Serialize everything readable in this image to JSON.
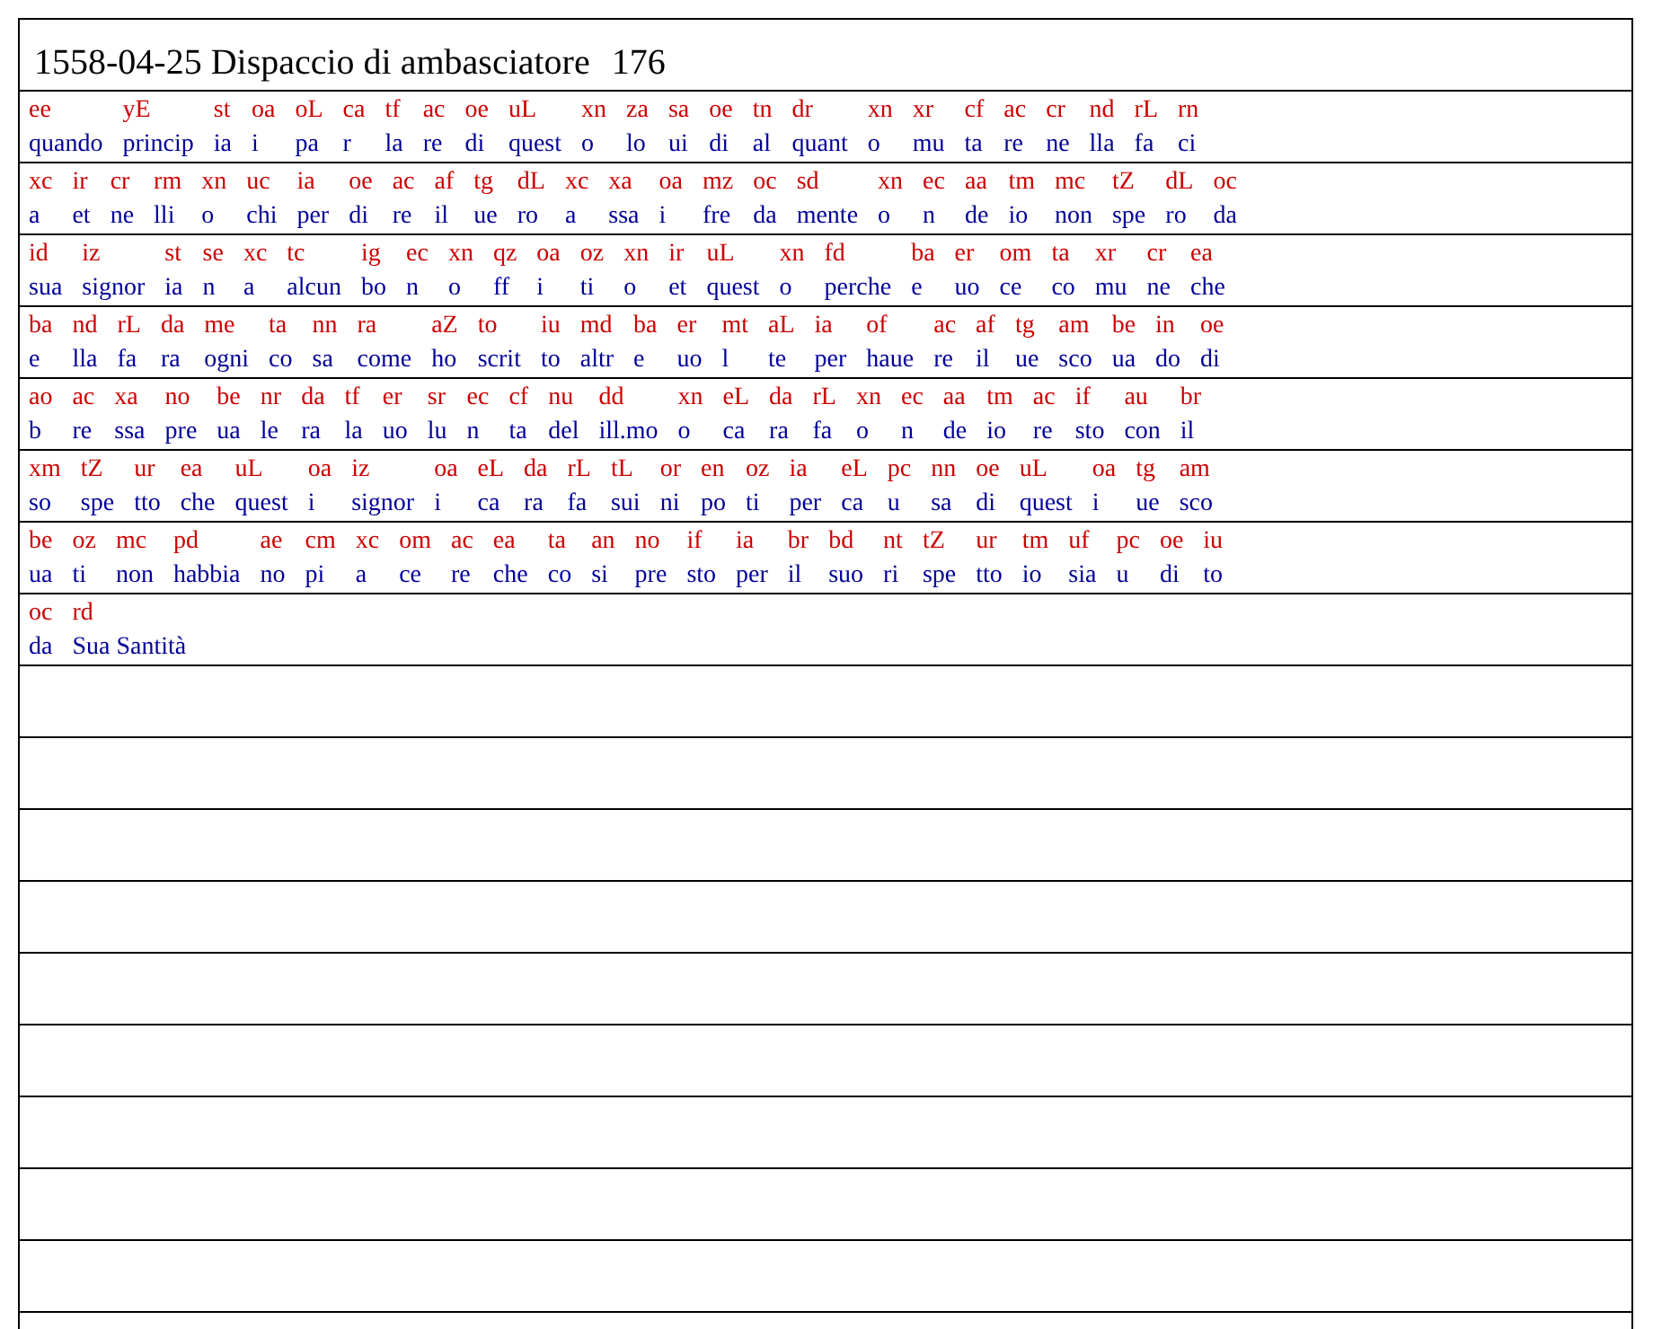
{
  "title": {
    "heading": "1558-04-25 Dispaccio di ambasciatore",
    "number": "176"
  },
  "rows": [
    {
      "pairs": [
        {
          "code": "ee",
          "plain": "quando"
        },
        {
          "code": "yE",
          "plain": "princip"
        },
        {
          "code": "st",
          "plain": "ia"
        },
        {
          "code": "oa",
          "plain": "i"
        },
        {
          "code": "oL",
          "plain": "pa"
        },
        {
          "code": "ca",
          "plain": "r"
        },
        {
          "code": "tf",
          "plain": "la"
        },
        {
          "code": "ac",
          "plain": "re"
        },
        {
          "code": "oe",
          "plain": "di"
        },
        {
          "code": "uL",
          "plain": "quest"
        },
        {
          "code": "xn",
          "plain": "o"
        },
        {
          "code": "za",
          "plain": "lo"
        },
        {
          "code": "sa",
          "plain": "ui"
        },
        {
          "code": "oe",
          "plain": "di"
        },
        {
          "code": "tn",
          "plain": "al"
        },
        {
          "code": "dr",
          "plain": "quant"
        },
        {
          "code": "xn",
          "plain": "o"
        },
        {
          "code": "xr",
          "plain": "mu"
        },
        {
          "code": "cf",
          "plain": "ta"
        },
        {
          "code": "ac",
          "plain": "re"
        },
        {
          "code": "cr",
          "plain": "ne"
        },
        {
          "code": "nd",
          "plain": "lla"
        },
        {
          "code": "rL",
          "plain": "fa"
        },
        {
          "code": "rn",
          "plain": "ci"
        }
      ]
    },
    {
      "pairs": [
        {
          "code": "xc",
          "plain": "a"
        },
        {
          "code": "ir",
          "plain": "et"
        },
        {
          "code": "cr",
          "plain": "ne"
        },
        {
          "code": "rm",
          "plain": "lli"
        },
        {
          "code": "xn",
          "plain": "o"
        },
        {
          "code": "uc",
          "plain": "chi"
        },
        {
          "code": "ia",
          "plain": "per"
        },
        {
          "code": "oe",
          "plain": "di"
        },
        {
          "code": "ac",
          "plain": "re"
        },
        {
          "code": "af",
          "plain": "il"
        },
        {
          "code": "tg",
          "plain": "ue"
        },
        {
          "code": "dL",
          "plain": "ro"
        },
        {
          "code": "xc",
          "plain": "a"
        },
        {
          "code": "xa",
          "plain": "ssa"
        },
        {
          "code": "oa",
          "plain": "i"
        },
        {
          "code": "mz",
          "plain": "fre"
        },
        {
          "code": "oc",
          "plain": "da"
        },
        {
          "code": "sd",
          "plain": "mente"
        },
        {
          "code": "xn",
          "plain": "o"
        },
        {
          "code": "ec",
          "plain": "n"
        },
        {
          "code": "aa",
          "plain": "de"
        },
        {
          "code": "tm",
          "plain": "io"
        },
        {
          "code": "mc",
          "plain": "non"
        },
        {
          "code": "tZ",
          "plain": "spe"
        },
        {
          "code": "dL",
          "plain": "ro"
        },
        {
          "code": "oc",
          "plain": "da"
        }
      ]
    },
    {
      "pairs": [
        {
          "code": "id",
          "plain": "sua"
        },
        {
          "code": "iz",
          "plain": "signor"
        },
        {
          "code": "st",
          "plain": "ia"
        },
        {
          "code": "se",
          "plain": "n"
        },
        {
          "code": "xc",
          "plain": "a"
        },
        {
          "code": "tc",
          "plain": "alcun"
        },
        {
          "code": "ig",
          "plain": "bo"
        },
        {
          "code": "ec",
          "plain": "n"
        },
        {
          "code": "xn",
          "plain": "o"
        },
        {
          "code": "qz",
          "plain": "ff"
        },
        {
          "code": "oa",
          "plain": "i"
        },
        {
          "code": "oz",
          "plain": "ti"
        },
        {
          "code": "xn",
          "plain": "o"
        },
        {
          "code": "ir",
          "plain": "et"
        },
        {
          "code": "uL",
          "plain": "quest"
        },
        {
          "code": "xn",
          "plain": "o"
        },
        {
          "code": "fd",
          "plain": "perche"
        },
        {
          "code": "ba",
          "plain": "e"
        },
        {
          "code": "er",
          "plain": "uo"
        },
        {
          "code": "om",
          "plain": "ce"
        },
        {
          "code": "ta",
          "plain": "co"
        },
        {
          "code": "xr",
          "plain": "mu"
        },
        {
          "code": "cr",
          "plain": "ne"
        },
        {
          "code": "ea",
          "plain": "che"
        }
      ]
    },
    {
      "pairs": [
        {
          "code": "ba",
          "plain": "e"
        },
        {
          "code": "nd",
          "plain": "lla"
        },
        {
          "code": "rL",
          "plain": "fa"
        },
        {
          "code": "da",
          "plain": "ra"
        },
        {
          "code": "me",
          "plain": "ogni"
        },
        {
          "code": "ta",
          "plain": "co"
        },
        {
          "code": "nn",
          "plain": "sa"
        },
        {
          "code": "ra",
          "plain": "come"
        },
        {
          "code": "aZ",
          "plain": "ho"
        },
        {
          "code": "to",
          "plain": "scrit"
        },
        {
          "code": "iu",
          "plain": "to"
        },
        {
          "code": "md",
          "plain": "altr"
        },
        {
          "code": "ba",
          "plain": "e"
        },
        {
          "code": "er",
          "plain": "uo"
        },
        {
          "code": "mt",
          "plain": "l"
        },
        {
          "code": "aL",
          "plain": "te"
        },
        {
          "code": "ia",
          "plain": "per"
        },
        {
          "code": "of",
          "plain": "haue"
        },
        {
          "code": "ac",
          "plain": "re"
        },
        {
          "code": "af",
          "plain": "il"
        },
        {
          "code": "tg",
          "plain": "ue"
        },
        {
          "code": "am",
          "plain": "sco"
        },
        {
          "code": "be",
          "plain": "ua"
        },
        {
          "code": "in",
          "plain": "do"
        },
        {
          "code": "oe",
          "plain": "di"
        }
      ]
    },
    {
      "pairs": [
        {
          "code": "ao",
          "plain": "b"
        },
        {
          "code": "ac",
          "plain": "re"
        },
        {
          "code": "xa",
          "plain": "ssa"
        },
        {
          "code": "no",
          "plain": "pre"
        },
        {
          "code": "be",
          "plain": "ua"
        },
        {
          "code": "nr",
          "plain": "le"
        },
        {
          "code": "da",
          "plain": "ra"
        },
        {
          "code": "tf",
          "plain": "la"
        },
        {
          "code": "er",
          "plain": "uo"
        },
        {
          "code": "sr",
          "plain": "lu"
        },
        {
          "code": "ec",
          "plain": "n"
        },
        {
          "code": "cf",
          "plain": "ta"
        },
        {
          "code": "nu",
          "plain": "del"
        },
        {
          "code": "dd",
          "plain": "ill.mo"
        },
        {
          "code": "xn",
          "plain": "o"
        },
        {
          "code": "eL",
          "plain": "ca"
        },
        {
          "code": "da",
          "plain": "ra"
        },
        {
          "code": "rL",
          "plain": "fa"
        },
        {
          "code": "xn",
          "plain": "o"
        },
        {
          "code": "ec",
          "plain": "n"
        },
        {
          "code": "aa",
          "plain": "de"
        },
        {
          "code": "tm",
          "plain": "io"
        },
        {
          "code": "ac",
          "plain": "re"
        },
        {
          "code": "if",
          "plain": "sto"
        },
        {
          "code": "au",
          "plain": "con"
        },
        {
          "code": "br",
          "plain": "il"
        }
      ]
    },
    {
      "pairs": [
        {
          "code": "xm",
          "plain": "so"
        },
        {
          "code": "tZ",
          "plain": "spe"
        },
        {
          "code": "ur",
          "plain": "tto"
        },
        {
          "code": "ea",
          "plain": "che"
        },
        {
          "code": "uL",
          "plain": "quest"
        },
        {
          "code": "oa",
          "plain": "i"
        },
        {
          "code": "iz",
          "plain": "signor"
        },
        {
          "code": "oa",
          "plain": "i"
        },
        {
          "code": "eL",
          "plain": "ca"
        },
        {
          "code": "da",
          "plain": "ra"
        },
        {
          "code": "rL",
          "plain": "fa"
        },
        {
          "code": "tL",
          "plain": "sui"
        },
        {
          "code": "or",
          "plain": "ni"
        },
        {
          "code": "en",
          "plain": "po"
        },
        {
          "code": "oz",
          "plain": "ti"
        },
        {
          "code": "ia",
          "plain": "per"
        },
        {
          "code": "eL",
          "plain": "ca"
        },
        {
          "code": "pc",
          "plain": "u"
        },
        {
          "code": "nn",
          "plain": "sa"
        },
        {
          "code": "oe",
          "plain": "di"
        },
        {
          "code": "uL",
          "plain": "quest"
        },
        {
          "code": "oa",
          "plain": "i"
        },
        {
          "code": "tg",
          "plain": "ue"
        },
        {
          "code": "am",
          "plain": "sco"
        }
      ]
    },
    {
      "pairs": [
        {
          "code": "be",
          "plain": "ua"
        },
        {
          "code": "oz",
          "plain": "ti"
        },
        {
          "code": "mc",
          "plain": "non"
        },
        {
          "code": "pd",
          "plain": "habbia"
        },
        {
          "code": "ae",
          "plain": "no"
        },
        {
          "code": "cm",
          "plain": "pi"
        },
        {
          "code": "xc",
          "plain": "a"
        },
        {
          "code": "om",
          "plain": "ce"
        },
        {
          "code": "ac",
          "plain": "re"
        },
        {
          "code": "ea",
          "plain": "che"
        },
        {
          "code": "ta",
          "plain": "co"
        },
        {
          "code": "an",
          "plain": "si"
        },
        {
          "code": "no",
          "plain": "pre"
        },
        {
          "code": "if",
          "plain": "sto"
        },
        {
          "code": "ia",
          "plain": "per"
        },
        {
          "code": "br",
          "plain": "il"
        },
        {
          "code": "bd",
          "plain": "suo"
        },
        {
          "code": "nt",
          "plain": "ri"
        },
        {
          "code": "tZ",
          "plain": "spe"
        },
        {
          "code": "ur",
          "plain": "tto"
        },
        {
          "code": "tm",
          "plain": "io"
        },
        {
          "code": "uf",
          "plain": "sia"
        },
        {
          "code": "pc",
          "plain": "u"
        },
        {
          "code": "oe",
          "plain": "di"
        },
        {
          "code": "iu",
          "plain": "to"
        }
      ]
    },
    {
      "pairs": [
        {
          "code": "oc",
          "plain": "da"
        },
        {
          "code": "rd",
          "plain": "Sua Santità"
        }
      ]
    }
  ]
}
